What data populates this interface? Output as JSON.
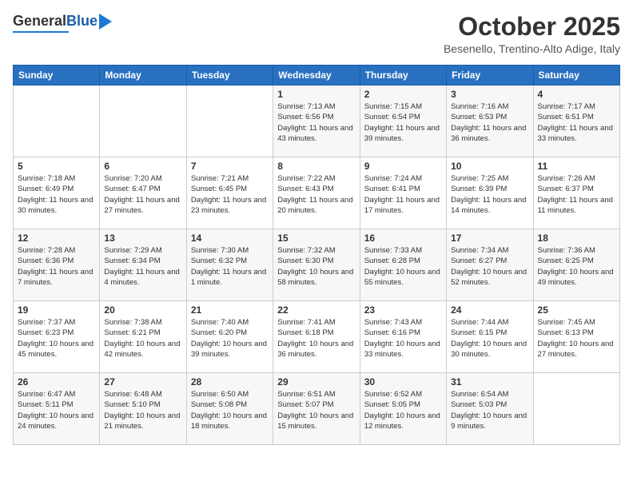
{
  "header": {
    "logo_general": "General",
    "logo_blue": "Blue",
    "month": "October 2025",
    "location": "Besenello, Trentino-Alto Adige, Italy"
  },
  "days_of_week": [
    "Sunday",
    "Monday",
    "Tuesday",
    "Wednesday",
    "Thursday",
    "Friday",
    "Saturday"
  ],
  "weeks": [
    [
      {
        "day": "",
        "content": ""
      },
      {
        "day": "",
        "content": ""
      },
      {
        "day": "",
        "content": ""
      },
      {
        "day": "1",
        "content": "Sunrise: 7:13 AM\nSunset: 6:56 PM\nDaylight: 11 hours and 43 minutes."
      },
      {
        "day": "2",
        "content": "Sunrise: 7:15 AM\nSunset: 6:54 PM\nDaylight: 11 hours and 39 minutes."
      },
      {
        "day": "3",
        "content": "Sunrise: 7:16 AM\nSunset: 6:53 PM\nDaylight: 11 hours and 36 minutes."
      },
      {
        "day": "4",
        "content": "Sunrise: 7:17 AM\nSunset: 6:51 PM\nDaylight: 11 hours and 33 minutes."
      }
    ],
    [
      {
        "day": "5",
        "content": "Sunrise: 7:18 AM\nSunset: 6:49 PM\nDaylight: 11 hours and 30 minutes."
      },
      {
        "day": "6",
        "content": "Sunrise: 7:20 AM\nSunset: 6:47 PM\nDaylight: 11 hours and 27 minutes."
      },
      {
        "day": "7",
        "content": "Sunrise: 7:21 AM\nSunset: 6:45 PM\nDaylight: 11 hours and 23 minutes."
      },
      {
        "day": "8",
        "content": "Sunrise: 7:22 AM\nSunset: 6:43 PM\nDaylight: 11 hours and 20 minutes."
      },
      {
        "day": "9",
        "content": "Sunrise: 7:24 AM\nSunset: 6:41 PM\nDaylight: 11 hours and 17 minutes."
      },
      {
        "day": "10",
        "content": "Sunrise: 7:25 AM\nSunset: 6:39 PM\nDaylight: 11 hours and 14 minutes."
      },
      {
        "day": "11",
        "content": "Sunrise: 7:26 AM\nSunset: 6:37 PM\nDaylight: 11 hours and 11 minutes."
      }
    ],
    [
      {
        "day": "12",
        "content": "Sunrise: 7:28 AM\nSunset: 6:36 PM\nDaylight: 11 hours and 7 minutes."
      },
      {
        "day": "13",
        "content": "Sunrise: 7:29 AM\nSunset: 6:34 PM\nDaylight: 11 hours and 4 minutes."
      },
      {
        "day": "14",
        "content": "Sunrise: 7:30 AM\nSunset: 6:32 PM\nDaylight: 11 hours and 1 minute."
      },
      {
        "day": "15",
        "content": "Sunrise: 7:32 AM\nSunset: 6:30 PM\nDaylight: 10 hours and 58 minutes."
      },
      {
        "day": "16",
        "content": "Sunrise: 7:33 AM\nSunset: 6:28 PM\nDaylight: 10 hours and 55 minutes."
      },
      {
        "day": "17",
        "content": "Sunrise: 7:34 AM\nSunset: 6:27 PM\nDaylight: 10 hours and 52 minutes."
      },
      {
        "day": "18",
        "content": "Sunrise: 7:36 AM\nSunset: 6:25 PM\nDaylight: 10 hours and 49 minutes."
      }
    ],
    [
      {
        "day": "19",
        "content": "Sunrise: 7:37 AM\nSunset: 6:23 PM\nDaylight: 10 hours and 45 minutes."
      },
      {
        "day": "20",
        "content": "Sunrise: 7:38 AM\nSunset: 6:21 PM\nDaylight: 10 hours and 42 minutes."
      },
      {
        "day": "21",
        "content": "Sunrise: 7:40 AM\nSunset: 6:20 PM\nDaylight: 10 hours and 39 minutes."
      },
      {
        "day": "22",
        "content": "Sunrise: 7:41 AM\nSunset: 6:18 PM\nDaylight: 10 hours and 36 minutes."
      },
      {
        "day": "23",
        "content": "Sunrise: 7:43 AM\nSunset: 6:16 PM\nDaylight: 10 hours and 33 minutes."
      },
      {
        "day": "24",
        "content": "Sunrise: 7:44 AM\nSunset: 6:15 PM\nDaylight: 10 hours and 30 minutes."
      },
      {
        "day": "25",
        "content": "Sunrise: 7:45 AM\nSunset: 6:13 PM\nDaylight: 10 hours and 27 minutes."
      }
    ],
    [
      {
        "day": "26",
        "content": "Sunrise: 6:47 AM\nSunset: 5:11 PM\nDaylight: 10 hours and 24 minutes."
      },
      {
        "day": "27",
        "content": "Sunrise: 6:48 AM\nSunset: 5:10 PM\nDaylight: 10 hours and 21 minutes."
      },
      {
        "day": "28",
        "content": "Sunrise: 6:50 AM\nSunset: 5:08 PM\nDaylight: 10 hours and 18 minutes."
      },
      {
        "day": "29",
        "content": "Sunrise: 6:51 AM\nSunset: 5:07 PM\nDaylight: 10 hours and 15 minutes."
      },
      {
        "day": "30",
        "content": "Sunrise: 6:52 AM\nSunset: 5:05 PM\nDaylight: 10 hours and 12 minutes."
      },
      {
        "day": "31",
        "content": "Sunrise: 6:54 AM\nSunset: 5:03 PM\nDaylight: 10 hours and 9 minutes."
      },
      {
        "day": "",
        "content": ""
      }
    ]
  ]
}
